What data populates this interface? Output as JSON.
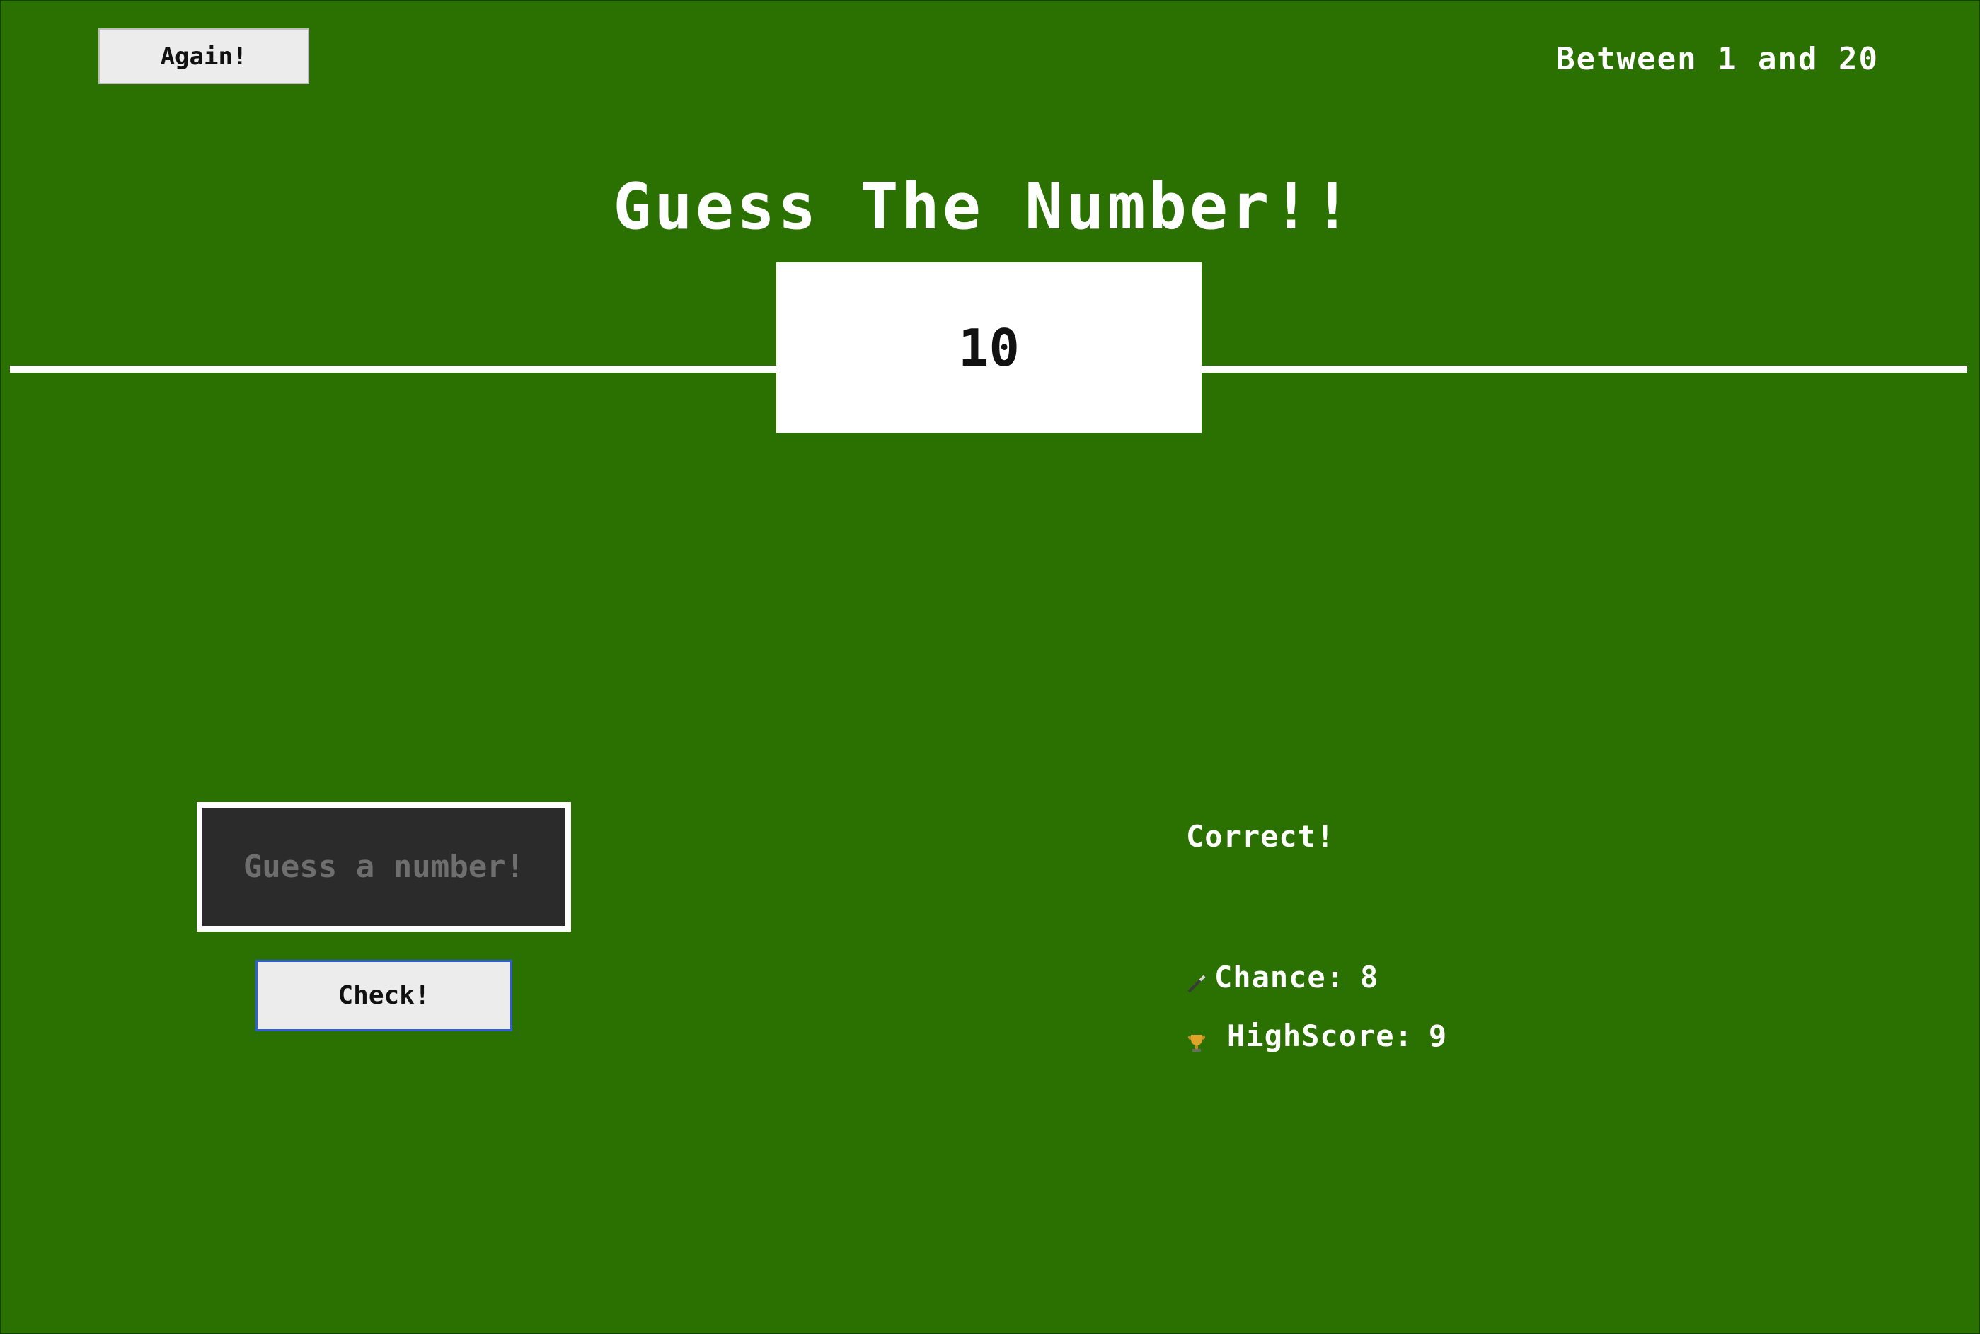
{
  "header": {
    "again_label": "Again!",
    "range_label": "Between 1 and 20"
  },
  "title": "Guess The Number!!",
  "secret_number": "10",
  "input": {
    "value": "",
    "placeholder": "Guess a number!"
  },
  "check_label": "Check!",
  "message": "Correct!",
  "stats": {
    "chance_label": "Chance:",
    "chance_value": "8",
    "chance_icon": "wand-icon",
    "highscore_label": "HighScore:",
    "highscore_value": "9",
    "highscore_icon": "trophy-icon"
  },
  "colors": {
    "background": "#2a7101",
    "panel": "#ffffff",
    "input_bg": "#2b2b2b",
    "button_bg": "#ececec",
    "focus_border": "#2d5fd6"
  }
}
